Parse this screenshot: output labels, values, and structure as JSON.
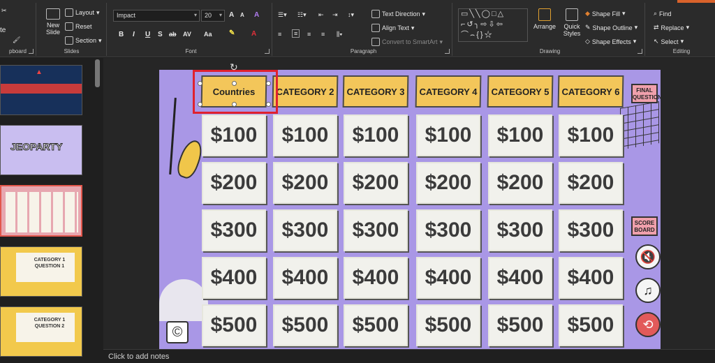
{
  "ribbon": {
    "groups": {
      "slides": "Slides",
      "font": "Font",
      "paragraph": "Paragraph",
      "drawing": "Drawing",
      "editing": "Editing",
      "clipboard": "pboard"
    },
    "slides_group": {
      "new_slide": "New Slide",
      "layout": "Layout",
      "reset": "Reset",
      "section": "Section"
    },
    "clipboard_group": {
      "paste": "te"
    },
    "font_group": {
      "font_name": "Impact",
      "font_size": "20",
      "bold": "B",
      "italic": "I",
      "underline": "U",
      "shadow": "S",
      "strike": "ab",
      "spacing": "AV",
      "case": "Aa",
      "grow": "A",
      "shrink": "A"
    },
    "paragraph_group": {
      "text_direction": "Text Direction",
      "align_text": "Align Text",
      "convert_smartart": "Convert to SmartArt"
    },
    "drawing_group": {
      "arrange": "Arrange",
      "quick_styles": "Quick Styles",
      "shape_fill": "Shape Fill",
      "shape_outline": "Shape Outline",
      "shape_effects": "Shape Effects"
    },
    "editing_group": {
      "find": "Find",
      "replace": "Replace",
      "select": "Select"
    }
  },
  "thumbnails": {
    "slide2_title": "JEOPARTY",
    "slide4_text": "CATEGORY 1\nQUESTION 1",
    "slide5_text": "CATEGORY 1\nQUESTION 2"
  },
  "slide": {
    "categories": [
      "Countries",
      "CATEGORY 2",
      "CATEGORY 3",
      "CATEGORY 4",
      "CATEGORY 5",
      "CATEGORY 6"
    ],
    "values": [
      "$100",
      "$200",
      "$300",
      "$400",
      "$500"
    ],
    "final_question": "FINAL QUESTION",
    "score_board": "SCORE BOARD",
    "mute_icon": "speaker-mute-icon",
    "music_icon": "music-note-icon",
    "back_icon": "return-arrow-icon",
    "copyright": "©"
  },
  "notes": {
    "placeholder": "Click to add notes"
  },
  "colors": {
    "slide_bg": "#a997e6",
    "category_fill": "#f3c65a",
    "selection": "#e0212e",
    "value_text": "#3b3b3b"
  }
}
